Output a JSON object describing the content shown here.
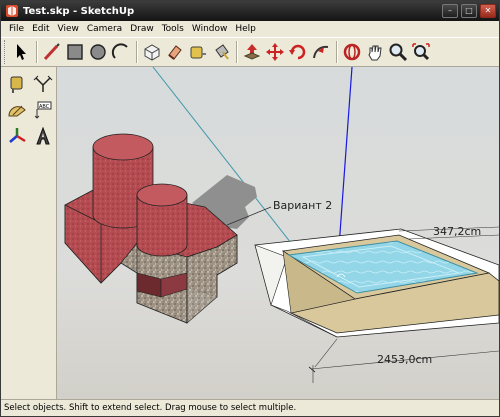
{
  "window": {
    "title": "Test.skp - SketchUp",
    "minimize_glyph": "–",
    "maximize_glyph": "□",
    "close_glyph": "✕"
  },
  "menu": {
    "items": [
      "File",
      "Edit",
      "View",
      "Camera",
      "Draw",
      "Tools",
      "Window",
      "Help"
    ]
  },
  "toolbar": {
    "tools": [
      "select-tool-icon",
      "line-tool-icon",
      "rectangle-tool-icon",
      "circle-tool-icon",
      "arc-tool-icon",
      "make-component-icon",
      "eraser-tool-icon",
      "tape-measure-icon",
      "paint-bucket-icon",
      "push-pull-icon",
      "move-tool-icon",
      "rotate-tool-icon",
      "follow-me-icon",
      "orbit-tool-icon",
      "pan-tool-icon",
      "zoom-tool-icon",
      "zoom-extents-icon"
    ]
  },
  "left_toolbar": {
    "tools": [
      "tape-measure-icon",
      "dimension-tool-icon",
      "protractor-icon",
      "text-tool-icon",
      "axes-tool-icon",
      "3d-text-icon"
    ]
  },
  "canvas": {
    "label_variant": "Вариант 2",
    "dimension_width": "347,2cm",
    "dimension_length": "2453,0cm",
    "colors": {
      "background": "#d8dbda",
      "brick_red": "#b44c50",
      "granite": "#a79c8c",
      "pool_frame": "#d8c79b",
      "water": "#8fd4e6",
      "axis_blue": "#1a1ae0",
      "axis_cyan": "#3a9aa8"
    }
  },
  "status": {
    "text": "Select objects. Shift to extend select. Drag mouse to select multiple."
  }
}
